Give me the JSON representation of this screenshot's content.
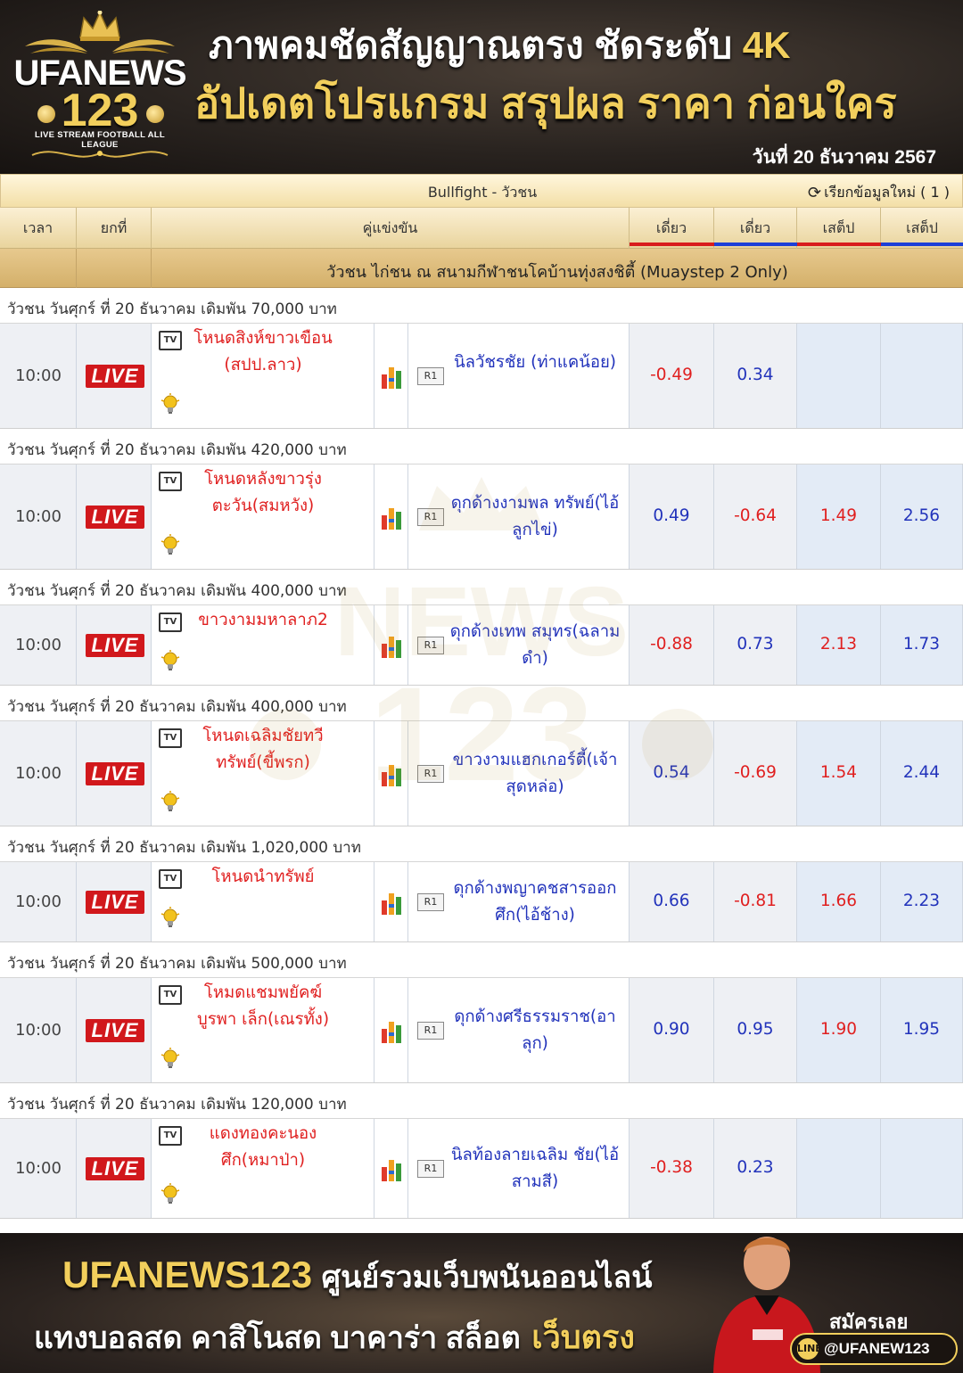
{
  "header": {
    "logo_brand": "UFANEWS",
    "logo_number": "123",
    "logo_tagline": "LIVE STREAM FOOTBALL ALL LEAGUE",
    "headline_1": "ภาพคมชัดสัญญาณตรง ชัดระดับ",
    "headline_1_accent": "4K",
    "headline_2": "อัปเดตโปรแกรม สรุปผล ราคา ก่อนใคร",
    "date": "วันที่  20 ธันวาคม 2567"
  },
  "table": {
    "title": "Bullfight - วัวชน",
    "refresh_label": "เรียกข้อมูลใหม่ ( 1 )",
    "columns": {
      "time": "เวลา",
      "round": "ยกที่",
      "match": "คู่แข่งขัน",
      "single_1": "เดี่ยว",
      "single_2": "เดี่ยว",
      "step_1": "เสต็ป",
      "step_2": "เสต็ป"
    },
    "league": "วัวชน ไก่ชน ณ สนามกีฬาชนโคบ้านทุ่งสงชิตี้ (Muaystep 2 Only)",
    "live_label": "LIVE",
    "round_label": "R1",
    "matches": [
      {
        "section": "วัวชน วันศุกร์ ที่ 20 ธันวาคม เดิมพัน 70,000 บาท",
        "time": "10:00",
        "home": "โหนดสิงห์ขาวเขือน (สปป.ลาว)",
        "away": "นิลวัชรชัย (ท่าแคน้อย)",
        "o1": "-0.49",
        "o2": "0.34",
        "o3": "",
        "o4": ""
      },
      {
        "section": "วัวชน วันศุกร์ ที่ 20 ธันวาคม เดิมพัน 420,000 บาท",
        "time": "10:00",
        "home": "โหนดหลังขาวรุ่ง ตะวัน(สมหวัง)",
        "away": "ดุกด้างงามพล ทรัพย์(ไอ้ลูกไข่)",
        "o1": "0.49",
        "o2": "-0.64",
        "o3": "1.49",
        "o4": "2.56"
      },
      {
        "section": "วัวชน วันศุกร์ ที่ 20 ธันวาคม เดิมพัน 400,000 บาท",
        "time": "10:00",
        "home": "ขาวงามมหาลาภ2",
        "away": "ดุกด้างเทพ สมุทร(ฉลามดำ)",
        "o1": "-0.88",
        "o2": "0.73",
        "o3": "2.13",
        "o4": "1.73"
      },
      {
        "section": "วัวชน วันศุกร์ ที่ 20 ธันวาคม เดิมพัน 400,000 บาท",
        "time": "10:00",
        "home": "โหนดเฉลิมชัยทวี ทรัพย์(ขี้พรก)",
        "away": "ขาวงามแฮกเกอร์ตี้(เจ้า สุดหล่อ)",
        "o1": "0.54",
        "o2": "-0.69",
        "o3": "1.54",
        "o4": "2.44"
      },
      {
        "section": "วัวชน วันศุกร์ ที่ 20 ธันวาคม เดิมพัน 1,020,000 บาท",
        "time": "10:00",
        "home": "โหนดนำทรัพย์",
        "away": "ดุกด้างพญาคชสารออก ศึก(ไอ้ช้าง)",
        "o1": "0.66",
        "o2": "-0.81",
        "o3": "1.66",
        "o4": "2.23"
      },
      {
        "section": "วัวชน วันศุกร์ ที่ 20 ธันวาคม เดิมพัน 500,000 บาท",
        "time": "10:00",
        "home": "โหมดแชมพยัคฆ์บูรพา เล็ก(เณรทั้ง)",
        "away": "ดุกด้างศรีธรรมราช(อา ลุก)",
        "o1": "0.90",
        "o2": "0.95",
        "o3": "1.90",
        "o4": "1.95"
      },
      {
        "section": "วัวชน วันศุกร์ ที่ 20 ธันวาคม เดิมพัน 120,000 บาท",
        "time": "10:00",
        "home": "แดงทองคะนอง ศึก(หมาป่า)",
        "away": "นิลท้องลายเฉลิม ชัย(ไอ้สามสี)",
        "o1": "-0.38",
        "o2": "0.23",
        "o3": "",
        "o4": ""
      }
    ]
  },
  "footer": {
    "brand": "UFANEWS123",
    "line_1": "ศูนย์รวมเว็บพนันออนไลน์",
    "line_2": "แทงบอลสด คาสิโนสด บาคาร่า สล็อต",
    "line_2_accent": "เว็บตรง",
    "signup": "สมัครเลย",
    "line_id": "@UFANEW123"
  },
  "colors": {
    "gold": "#f2cf5c",
    "live_red": "#d1181c",
    "home_red": "#e02020",
    "away_blue": "#2233bb",
    "head_bar_red": "#d81c1c",
    "head_bar_blue": "#1c3fd8"
  },
  "icons": [
    "crown-icon",
    "football-icon",
    "refresh-icon",
    "tv-icon",
    "lightbulb-icon",
    "bar-chart-icon",
    "line-icon"
  ]
}
